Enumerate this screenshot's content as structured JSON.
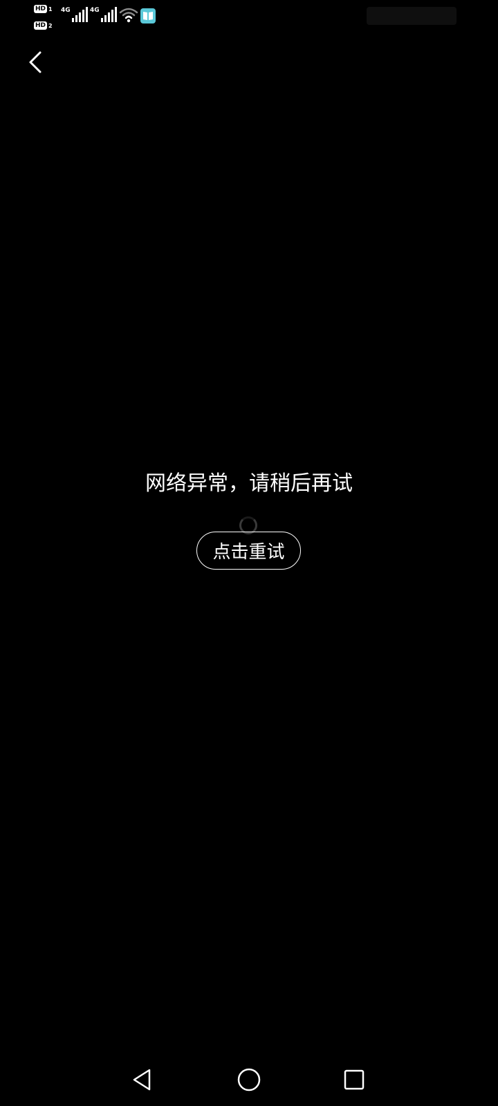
{
  "status_bar": {
    "sim1": {
      "badge": "HD",
      "slot": "1",
      "network": "4G"
    },
    "sim2": {
      "badge": "HD",
      "slot": "2",
      "network": "4G"
    },
    "icons": [
      "wifi-icon",
      "reader-app-icon"
    ],
    "accent_color": "#5ac8d8"
  },
  "header": {
    "back_icon": "chevron-left-icon"
  },
  "main": {
    "error_message": "网络异常，请稍后再试",
    "retry_label": "点击重试",
    "spinner_icon": "loading-spinner-icon"
  },
  "nav_bar": {
    "icons": [
      "back-triangle-icon",
      "home-circle-icon",
      "recents-square-icon"
    ]
  },
  "colors": {
    "background": "#000000",
    "text": "#ffffff"
  }
}
